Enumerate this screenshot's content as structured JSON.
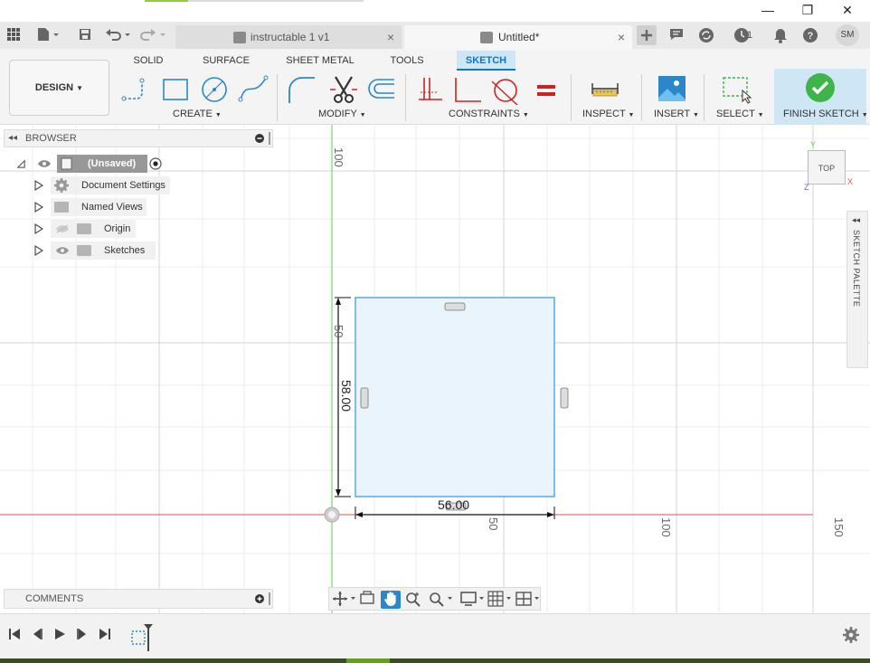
{
  "window": {
    "minimize": "—",
    "restore": "❐",
    "close": "✕"
  },
  "tabs": {
    "inactive_label": "instructable 1 v1",
    "active_label": "Untitled*",
    "close_glyph": "×"
  },
  "topbar": {
    "grid_icon": "⋮⋮⋮",
    "notifications_count": "1",
    "user_initials": "SM"
  },
  "toolbar": {
    "workspace_label": "DESIGN",
    "workspace_tabs": [
      "SOLID",
      "SURFACE",
      "SHEET METAL",
      "TOOLS",
      "SKETCH"
    ],
    "groups": [
      "CREATE",
      "MODIFY",
      "CONSTRAINTS",
      "INSPECT",
      "INSERT",
      "SELECT",
      "FINISH SKETCH"
    ],
    "accent_color": "#0a79c6",
    "finish_color": "#3eb44a"
  },
  "browser": {
    "title": "BROWSER",
    "root_label": "(Unsaved)",
    "items": [
      {
        "label": "Document Settings"
      },
      {
        "label": "Named Views"
      },
      {
        "label": "Origin"
      },
      {
        "label": "Sketches"
      }
    ]
  },
  "canvas": {
    "grid_labels": [
      "100",
      "50",
      "50",
      "100",
      "150"
    ],
    "dim_vertical": "58.00",
    "dim_horizontal": "56.00",
    "sketch_fill": "#e9f4fc",
    "sketch_stroke": "#5fb0e0"
  },
  "viewcube": {
    "face_label": "TOP",
    "axis_y": "Y",
    "axis_x": "X",
    "axis_z": "Z"
  },
  "palette": {
    "label": "SKETCH PALETTE"
  },
  "comments": {
    "title": "COMMENTS"
  }
}
